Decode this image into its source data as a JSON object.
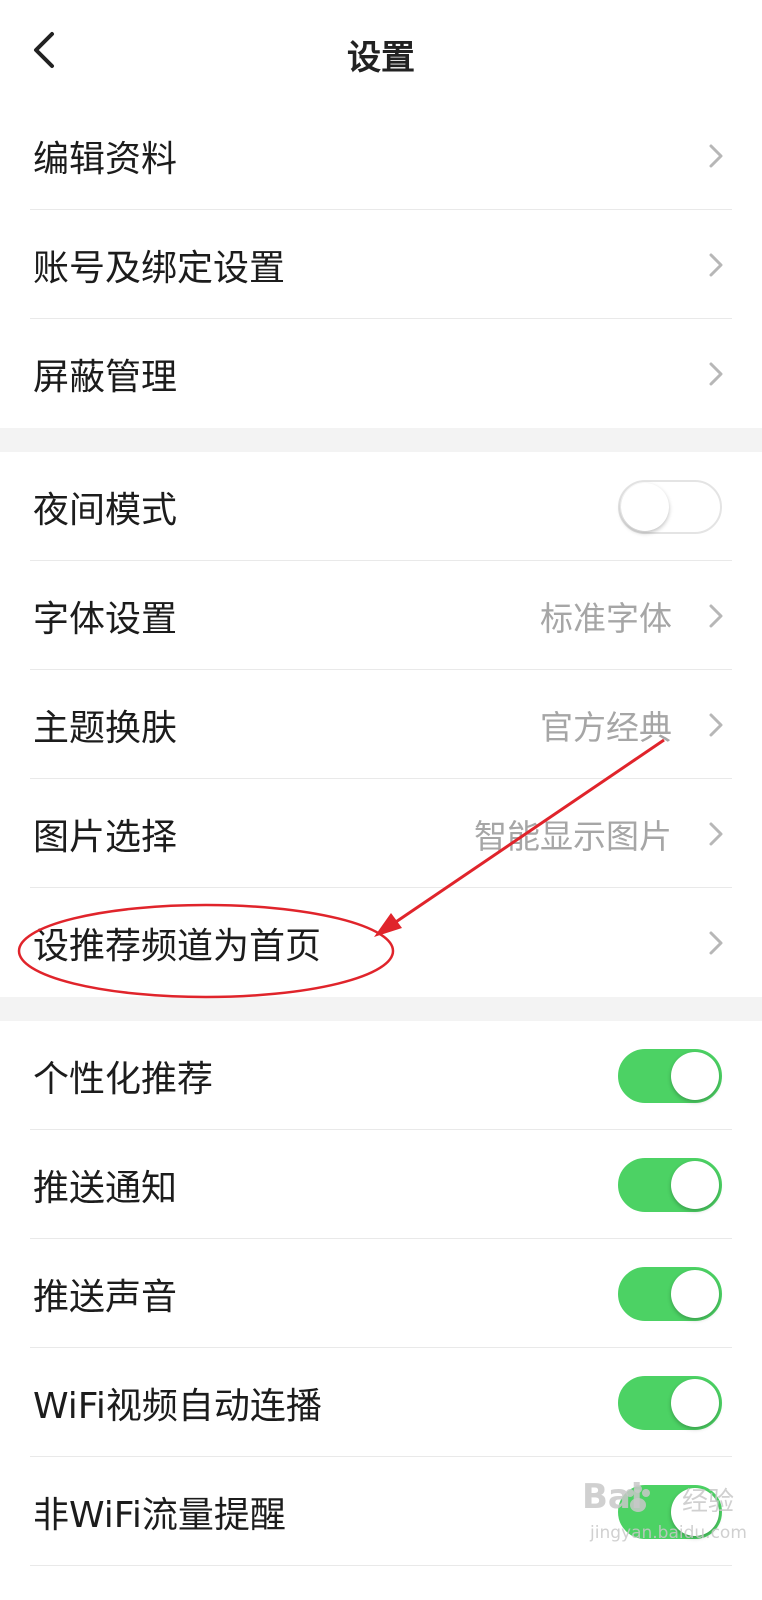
{
  "header": {
    "title": "设置"
  },
  "group1": [
    {
      "label": "编辑资料"
    },
    {
      "label": "账号及绑定设置"
    },
    {
      "label": "屏蔽管理"
    }
  ],
  "group2": [
    {
      "label": "夜间模式",
      "toggle": false
    },
    {
      "label": "字体设置",
      "value": "标准字体"
    },
    {
      "label": "主题换肤",
      "value": "官方经典"
    },
    {
      "label": "图片选择",
      "value": "智能显示图片"
    },
    {
      "label": "设推荐频道为首页"
    }
  ],
  "group3": [
    {
      "label": "个性化推荐",
      "toggle": true
    },
    {
      "label": "推送通知",
      "toggle": true
    },
    {
      "label": "推送声音",
      "toggle": true
    },
    {
      "label": "WiFi视频自动连播",
      "toggle": true
    },
    {
      "label": "非WiFi流量提醒",
      "toggle": true
    }
  ],
  "watermark": {
    "logo": "Bai",
    "logo_suffix": "经验",
    "url": "jingyan.baidu.com"
  },
  "colors": {
    "toggle_on": "#4cd264",
    "annotation": "#e0242b",
    "value_text": "#a6a6a6"
  }
}
